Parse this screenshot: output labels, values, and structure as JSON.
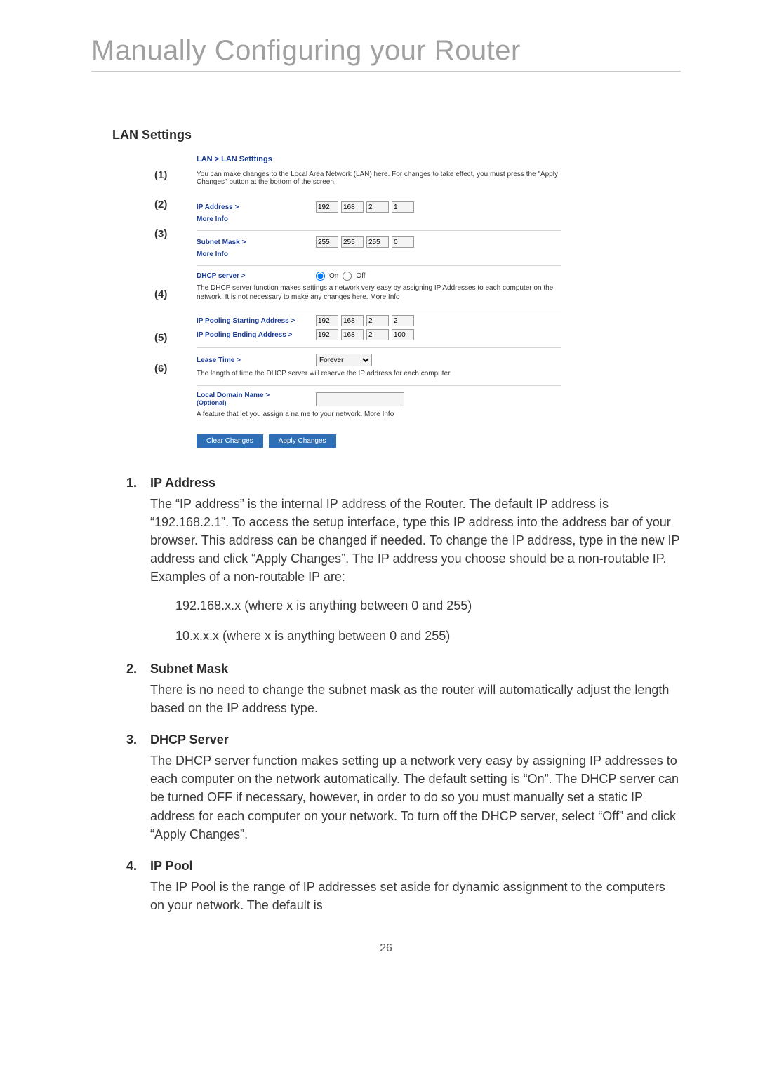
{
  "title": "Manually Configuring your Router",
  "section": "LAN Settings",
  "pageNumber": "26",
  "callouts": [
    "(1)",
    "(2)",
    "(3)",
    "(4)",
    "(5)",
    "(6)"
  ],
  "shot": {
    "breadcrumb": "LAN > LAN Setttings",
    "intro": "You can make changes to the Local Area Network (LAN) here. For changes to take effect, you must press the \"Apply Changes\" button at the bottom of the screen.",
    "ipAddress": {
      "label": "IP Address >",
      "more": "More Info",
      "o1": "192",
      "o2": "168",
      "o3": "2",
      "o4": "1"
    },
    "subnet": {
      "label": "Subnet Mask >",
      "more": "More Info",
      "o1": "255",
      "o2": "255",
      "o3": "255",
      "o4": "0"
    },
    "dhcp": {
      "label": "DHCP server >",
      "on": "On",
      "off": "Off",
      "desc": "The DHCP server function makes settings a network very easy by assigning IP Addresses to each computer on the network. It is not necessary to make any changes here. More Info"
    },
    "poolStart": {
      "label": "IP Pooling Starting Address >",
      "o1": "192",
      "o2": "168",
      "o3": "2",
      "o4": "2"
    },
    "poolEnd": {
      "label": "IP Pooling Ending Address >",
      "o1": "192",
      "o2": "168",
      "o3": "2",
      "o4": "100"
    },
    "lease": {
      "label": "Lease Time >",
      "value": "Forever",
      "desc": "The length of time the DHCP server will reserve the IP address for each computer"
    },
    "domain": {
      "label": "Local Domain Name >",
      "optional": "(Optional)",
      "desc": "A feature that let you assign a na me to your network. More Info"
    },
    "btnClear": "Clear Changes",
    "btnApply": "Apply Changes"
  },
  "items": [
    {
      "n": "1.",
      "h": "IP Address",
      "p": "The “IP address” is the internal IP address of the Router. The default IP address is “192.168.2.1”. To access the setup interface, type this IP address into the address bar of your browser. This address can be changed if needed. To change the IP address, type in the new IP address and click “Apply Changes”. The IP address you choose should be a non-routable IP. Examples of a non-routable IP are:",
      "sub": [
        "192.168.x.x (where x is anything between 0 and 255)",
        "10.x.x.x (where x is anything between 0 and 255)"
      ]
    },
    {
      "n": "2.",
      "h": "Subnet Mask",
      "p": "There is no need to change the subnet mask as the router will automatically adjust the length based on the IP address type."
    },
    {
      "n": "3.",
      "h": "DHCP Server",
      "p": "The DHCP server function makes setting up a network very easy by assigning IP addresses to each computer on the network automatically. The default setting is “On”. The DHCP server can be turned OFF if necessary, however, in order to do so you must manually set a static IP address for each computer on your network. To turn off the DHCP server, select “Off” and click “Apply Changes”."
    },
    {
      "n": "4.",
      "h": "IP Pool",
      "p": "The IP Pool is the range of IP addresses set aside for dynamic assignment to the computers on your network. The default is"
    }
  ]
}
